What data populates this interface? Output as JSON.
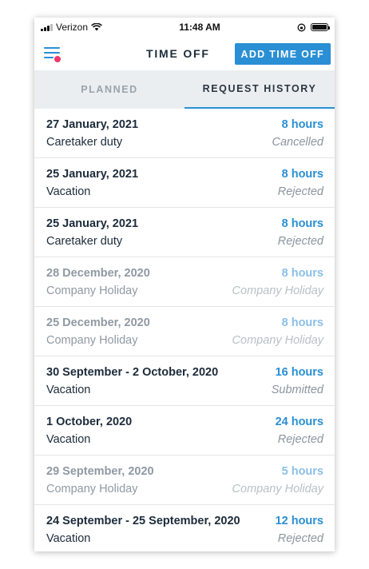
{
  "status_bar": {
    "carrier": "Verizon",
    "time": "11:48 AM"
  },
  "header": {
    "title": "TIME OFF",
    "add_button_label": "ADD TIME OFF"
  },
  "tabs": [
    {
      "label": "PLANNED",
      "active": false
    },
    {
      "label": "REQUEST HISTORY",
      "active": true
    }
  ],
  "colors": {
    "accent": "#2a8fd4",
    "notification_dot": "#f0376b"
  },
  "requests": [
    {
      "date": "27 January, 2021",
      "hours": "8 hours",
      "type": "Caretaker duty",
      "status": "Cancelled"
    },
    {
      "date": "25 January, 2021",
      "hours": "8 hours",
      "type": "Vacation",
      "status": "Rejected"
    },
    {
      "date": "25 January, 2021",
      "hours": "8 hours",
      "type": "Caretaker duty",
      "status": "Rejected"
    },
    {
      "date": "28 December, 2020",
      "hours": "8 hours",
      "type": "Company Holiday",
      "status": "Company Holiday"
    },
    {
      "date": "25 December, 2020",
      "hours": "8 hours",
      "type": "Company Holiday",
      "status": "Company Holiday"
    },
    {
      "date": "30 September - 2 October, 2020",
      "hours": "16 hours",
      "type": "Vacation",
      "status": "Submitted"
    },
    {
      "date": "1 October, 2020",
      "hours": "24 hours",
      "type": "Vacation",
      "status": "Rejected"
    },
    {
      "date": "29 September, 2020",
      "hours": "5 hours",
      "type": "Company Holiday",
      "status": "Company Holiday"
    },
    {
      "date": "24 September - 25 September, 2020",
      "hours": "12 hours",
      "type": "Vacation",
      "status": "Rejected"
    }
  ]
}
